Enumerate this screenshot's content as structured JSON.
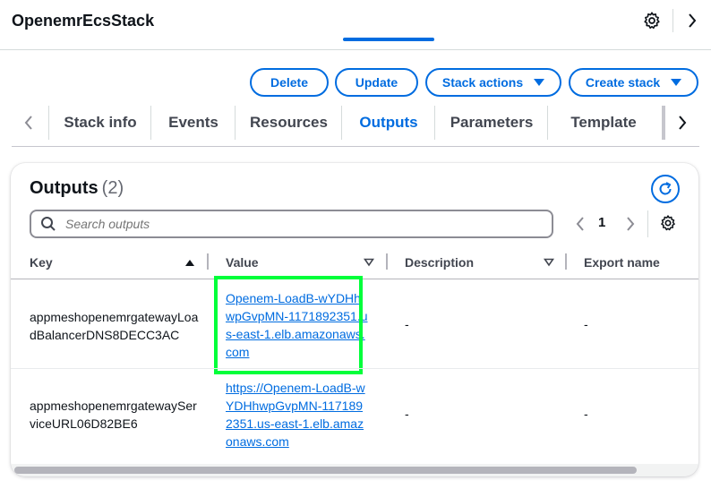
{
  "header": {
    "title": "OpenemrEcsStack"
  },
  "actions": {
    "delete_label": "Delete",
    "update_label": "Update",
    "stack_actions_label": "Stack actions",
    "create_stack_label": "Create stack"
  },
  "tabs": [
    {
      "label": "Stack info"
    },
    {
      "label": "Events"
    },
    {
      "label": "Resources"
    },
    {
      "label": "Outputs",
      "active": true
    },
    {
      "label": "Parameters"
    },
    {
      "label": "Template"
    }
  ],
  "outputs": {
    "title": "Outputs",
    "count": "(2)",
    "search_placeholder": "Search outputs",
    "page": "1",
    "columns": {
      "key": "Key",
      "value": "Value",
      "description": "Description",
      "export_name": "Export name"
    },
    "rows": [
      {
        "key": "appmeshopenemrgatewayLoadBalancerDNS8DECC3AC",
        "value": "Openem-LoadB-wYDHhwpGvpMN-1171892351.us-east-1.elb.amazonaws.com",
        "description": "-",
        "export_name": "-"
      },
      {
        "key": "appmeshopenemrgatewayServiceURL06D82BE6",
        "value": "https://Openem-LoadB-wYDHhwpGvpMN-1171892351.us-east-1.elb.amazonaws.com",
        "description": "-",
        "export_name": "-"
      }
    ]
  },
  "colors": {
    "accent": "#006ce0",
    "highlight": "#00ff3a",
    "text": "#0f141a"
  }
}
